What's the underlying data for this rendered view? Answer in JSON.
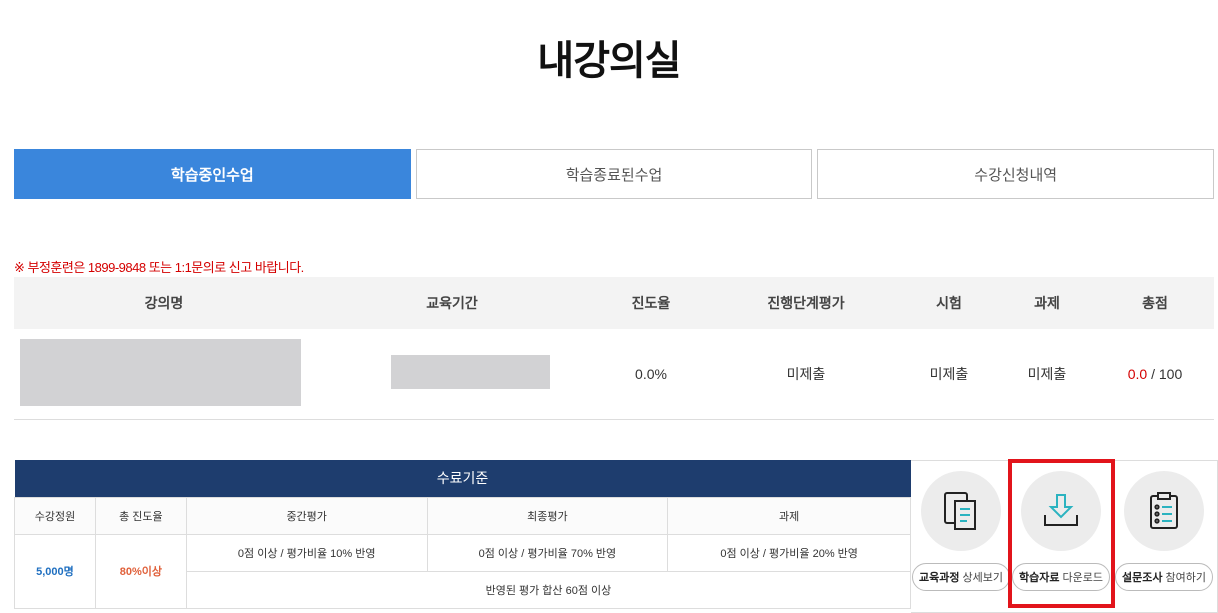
{
  "page_title": "내강의실",
  "tabs": [
    {
      "label": "학습중인수업",
      "active": true
    },
    {
      "label": "학습종료된수업",
      "active": false
    },
    {
      "label": "수강신청내역",
      "active": false
    }
  ],
  "notice": "※ 부정훈련은 1899-9848 또는 1:1문의로 신고 바랍니다.",
  "course_table": {
    "headers": [
      "강의명",
      "교육기간",
      "진도율",
      "진행단계평가",
      "시험",
      "과제",
      "총점"
    ],
    "row": {
      "progress": "0.0%",
      "stage_eval": "미제출",
      "exam": "미제출",
      "assignment": "미제출",
      "score_value": "0.0",
      "score_total": "/ 100"
    }
  },
  "criteria": {
    "title": "수료기준",
    "headers": [
      "수강정원",
      "총 진도율",
      "중간평가",
      "최종평가",
      "과제"
    ],
    "capacity": "5,000명",
    "progress_req": "80%이상",
    "midterm": "0점 이상 / 평가비율 10% 반영",
    "final": "0점 이상 / 평가비율 70% 반영",
    "assignment": "0점 이상 / 평가비율 20% 반영",
    "total_req": "반영된 평가 합산 60점 이상"
  },
  "actions": [
    {
      "bold": "교육과정",
      "rest": " 상세보기",
      "icon": "document-icon"
    },
    {
      "bold": "학습자료",
      "rest": " 다운로드",
      "icon": "download-icon"
    },
    {
      "bold": "설문조사",
      "rest": " 참여하기",
      "icon": "clipboard-icon"
    }
  ],
  "colors": {
    "tab_active": "#3a86dc",
    "criteria_head": "#1e3d6e",
    "notice": "#d40000",
    "highlight": "#e2141b"
  }
}
